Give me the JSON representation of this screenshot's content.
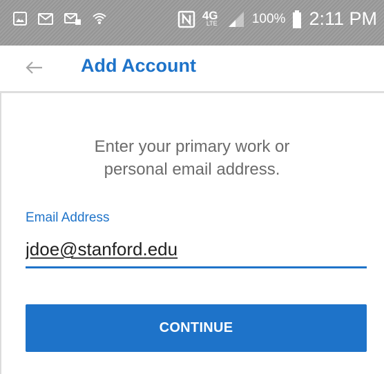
{
  "status_bar": {
    "left_icons": [
      "gallery-icon",
      "gmail-icon",
      "message-icon",
      "wifi-icon"
    ],
    "right_icons": [
      "nfc-icon",
      "4g-lte-icon",
      "signal-icon",
      "battery-icon"
    ],
    "network_label": "4G",
    "network_sub": "LTE",
    "battery_percent": "100%",
    "clock": "2:11 PM"
  },
  "app_bar": {
    "back_icon": "arrow-left-icon",
    "title": "Add Account"
  },
  "main": {
    "prompt_line1": "Enter your primary work or",
    "prompt_line2": "personal email address.",
    "email_label": "Email Address",
    "email_value": "jdoe@stanford.edu",
    "continue_label": "CONTINUE"
  },
  "colors": {
    "accent": "#1e73c9",
    "status_bar": "#9a9a9a",
    "prompt_text": "#6b6b6b"
  }
}
